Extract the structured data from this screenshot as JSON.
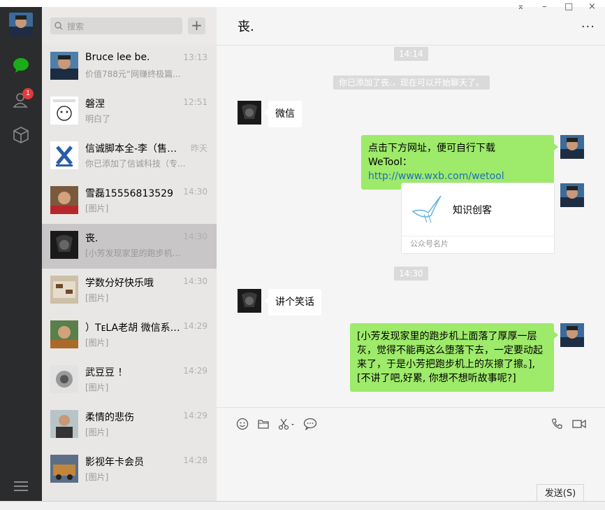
{
  "window": {
    "controls": [
      "⌅",
      "–",
      "□",
      "×"
    ]
  },
  "rail": {
    "unread_badge": "1"
  },
  "search": {
    "placeholder": "搜索",
    "add_label": "+"
  },
  "conversations": [
    {
      "name": "Bruce lee be.",
      "preview": "价值788元“网赚终极篇...",
      "time": "13:13"
    },
    {
      "name": "磐涅",
      "preview": "明白了",
      "time": "12:51"
    },
    {
      "name": "信诚脚本全-李（售后...",
      "preview": "你已添加了信诚科技（专...",
      "time": "昨天"
    },
    {
      "name": "雪磊15556813529",
      "preview": "[图片]",
      "time": "14:30"
    },
    {
      "name": "丧.",
      "preview": "[小芳发现家里的跑步机...",
      "time": "14:30"
    },
    {
      "name": "学数分好快乐哦",
      "preview": "[图片]",
      "time": "14:30"
    },
    {
      "name": "）TᴇLA老胡 微信系统...",
      "preview": "[图片]",
      "time": "14:29"
    },
    {
      "name": "武豆豆 ！",
      "preview": "[图片]",
      "time": "14:29"
    },
    {
      "name": "柔情的悲伤",
      "preview": "[图片]",
      "time": "14:29"
    },
    {
      "name": "影视年卡会员",
      "preview": "[图片]",
      "time": "14:28"
    }
  ],
  "chat": {
    "title": "丧.",
    "more": "···",
    "time1": "14:14",
    "system": "你已添加了丧.，现在可以开始聊天了。",
    "msg_in_1": "微信",
    "msg_out_1_line1": "点击下方网址，便可自行下载",
    "msg_out_1_prefix": "WeTool：",
    "msg_out_1_link": "http://www.wxb.com/wetool",
    "card_name": "知识创客",
    "card_footer": "公众号名片",
    "time2": "14:30",
    "msg_in_2": "讲个笑话",
    "msg_out_2": "[小芳发现家里的跑步机上面落了厚厚一层灰，觉得不能再这么堕落下去，一定要动起来了，于是小芳把跑步机上的灰擦了擦。],[不讲了吧,好累, 你想不想听故事呢?]",
    "send_label": "发送(S)"
  },
  "colors": {
    "rail": "#2b2c2e",
    "accent_green": "#1aad19",
    "bubble_out": "#9eea6a",
    "badge": "#e4393c"
  }
}
